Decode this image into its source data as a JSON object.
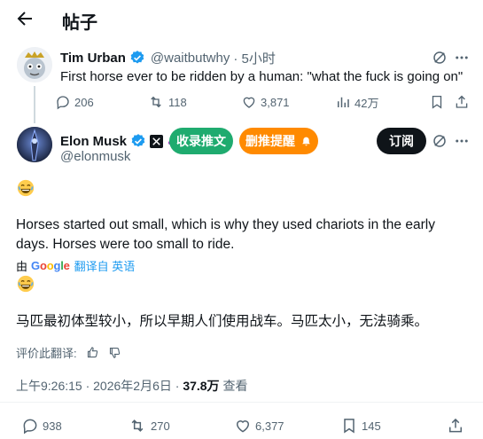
{
  "header": {
    "title": "帖子",
    "back_icon": "arrow-left-icon"
  },
  "parent_tweet": {
    "name": "Tim Urban",
    "handle": "@waitbutwhy",
    "time": "· 5小时",
    "text": "First horse ever to be ridden by a human: \"what the fuck is going on\"",
    "stats": {
      "replies": "206",
      "reposts": "118",
      "likes": "3,871",
      "views": "42万"
    }
  },
  "main_tweet": {
    "name": "Elon Musk",
    "handle": "@elonmusk",
    "buttons": {
      "collect": "收录推文",
      "delete_notify": "删推提醒",
      "subscribe": "订阅"
    },
    "emoji": "😂",
    "text_line1": "Horses started out small, which is why they used chariots in the early",
    "text_line2": "days. Horses were too small to ride.",
    "translate": {
      "by": "由",
      "google": "Google",
      "link": "翻译自 英语"
    },
    "translated_text": "马匹最初体型较小，所以早期人们使用战车。马匹太小，无法骑乘。",
    "rate_label": "评价此翻译:",
    "timestamp": "上午9:26:15 · 2026年2月6日 ·",
    "views": "37.8万",
    "views_label": "查看",
    "stats": {
      "replies": "938",
      "reposts": "270",
      "likes": "6,377",
      "bookmarks": "145"
    }
  },
  "colors": {
    "verified": "#1d9bf0",
    "green_pill": "#1fab6f",
    "orange_pill": "#ff8a00",
    "muted": "#536471"
  }
}
